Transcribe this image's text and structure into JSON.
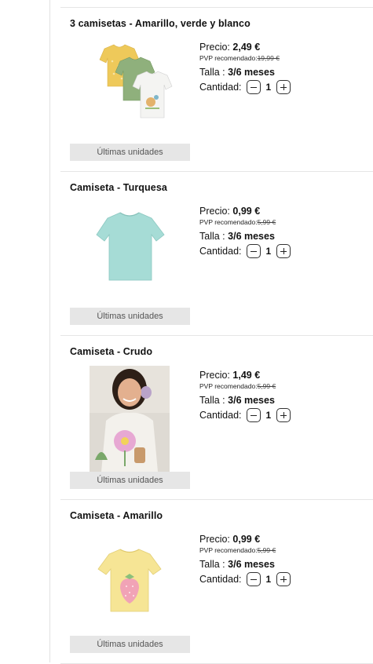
{
  "labels": {
    "price": "Precio:",
    "pvp": "PVP recomendado:",
    "talla": "Talla :",
    "cantidad": "Cantidad:"
  },
  "products": [
    {
      "title": "3 camisetas - Amarillo, verde y blanco",
      "price": "2,49 €",
      "pvp": "19,99 €",
      "talla": "3/6 meses",
      "quantity": "1",
      "badge": "Últimas unidades",
      "image": "three-tshirts-yellow-green-white"
    },
    {
      "title": "Camiseta - Turquesa",
      "price": "0,99 €",
      "pvp": "5,99 €",
      "talla": "3/6 meses",
      "quantity": "1",
      "badge": "Últimas unidades",
      "image": "tshirt-turquoise"
    },
    {
      "title": "Camiseta - Crudo",
      "price": "1,49 €",
      "pvp": "5,99 €",
      "talla": "3/6 meses",
      "quantity": "1",
      "badge": "Últimas unidades",
      "image": "girl-wearing-cream-tshirt"
    },
    {
      "title": "Camiseta - Amarillo",
      "price": "0,99 €",
      "pvp": "5,99 €",
      "talla": "3/6 meses",
      "quantity": "1",
      "badge": "Últimas unidades",
      "image": "tshirt-yellow-strawberry"
    }
  ]
}
